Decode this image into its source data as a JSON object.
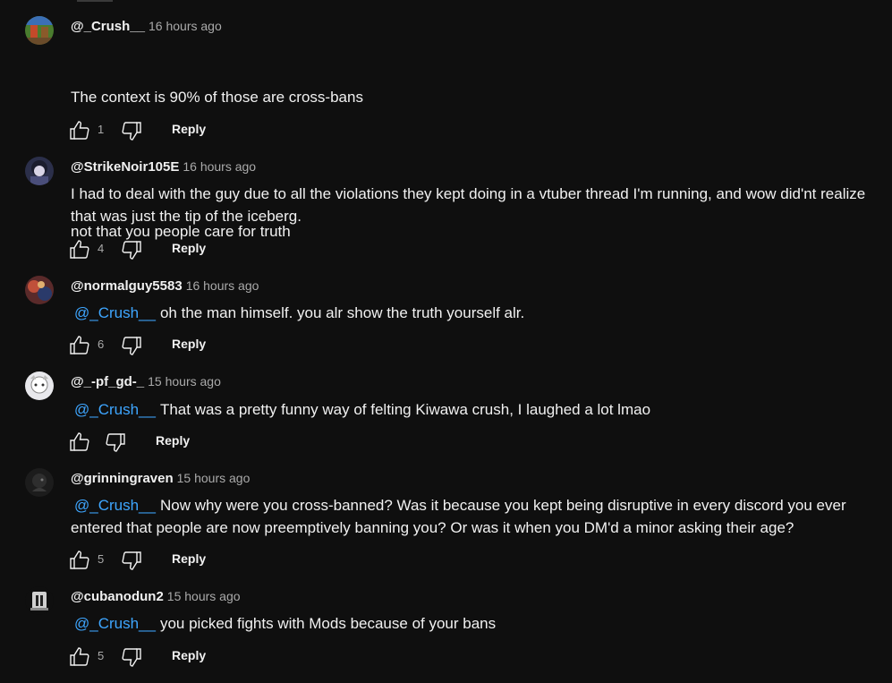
{
  "comments": [
    {
      "author": "@_Crush__",
      "time": "16 hours ago",
      "line1": "The context is 90% of those are cross-bans",
      "line2": "not that you people care for truth",
      "likes": "1",
      "reply": "Reply"
    },
    {
      "author": "@StrikeNoir105E",
      "time": "16 hours ago",
      "text": "I had to deal with the guy due to all the violations they kept doing in a vtuber thread I'm running, and wow did'nt realize that was just the tip of the iceberg.",
      "likes": "4",
      "reply": "Reply"
    },
    {
      "author": "@normalguy5583",
      "time": "16 hours ago",
      "mention": "@_Crush__",
      "text": "oh the man himself. you alr show the truth yourself alr.",
      "likes": "6",
      "reply": "Reply"
    },
    {
      "author": "@_-pf_gd-_",
      "time": "15 hours ago",
      "mention": "@_Crush__",
      "text": "That was a pretty funny way of felting Kiwawa crush, I laughed a lot lmao",
      "likes": "",
      "reply": "Reply"
    },
    {
      "author": "@grinningraven",
      "time": "15 hours ago",
      "mention": "@_Crush__",
      "text": "Now why were you cross-banned? Was it because you kept being disruptive in every discord you ever entered that people are now preemptively banning you? Or was it when you DM'd a minor asking their age?",
      "likes": "5",
      "reply": "Reply"
    },
    {
      "author": "@cubanodun2",
      "time": "15 hours ago",
      "mention": "@_Crush__",
      "text": "you picked fights with Mods because of your bans",
      "likes": "5",
      "reply": "Reply"
    }
  ],
  "icons": {
    "like": "thumbs-up-icon",
    "dislike": "thumbs-down-icon"
  },
  "colors": {
    "background": "#0f0f0f",
    "text": "#f1f1f1",
    "secondary": "#aaaaaa",
    "mention": "#3ea6ff"
  }
}
